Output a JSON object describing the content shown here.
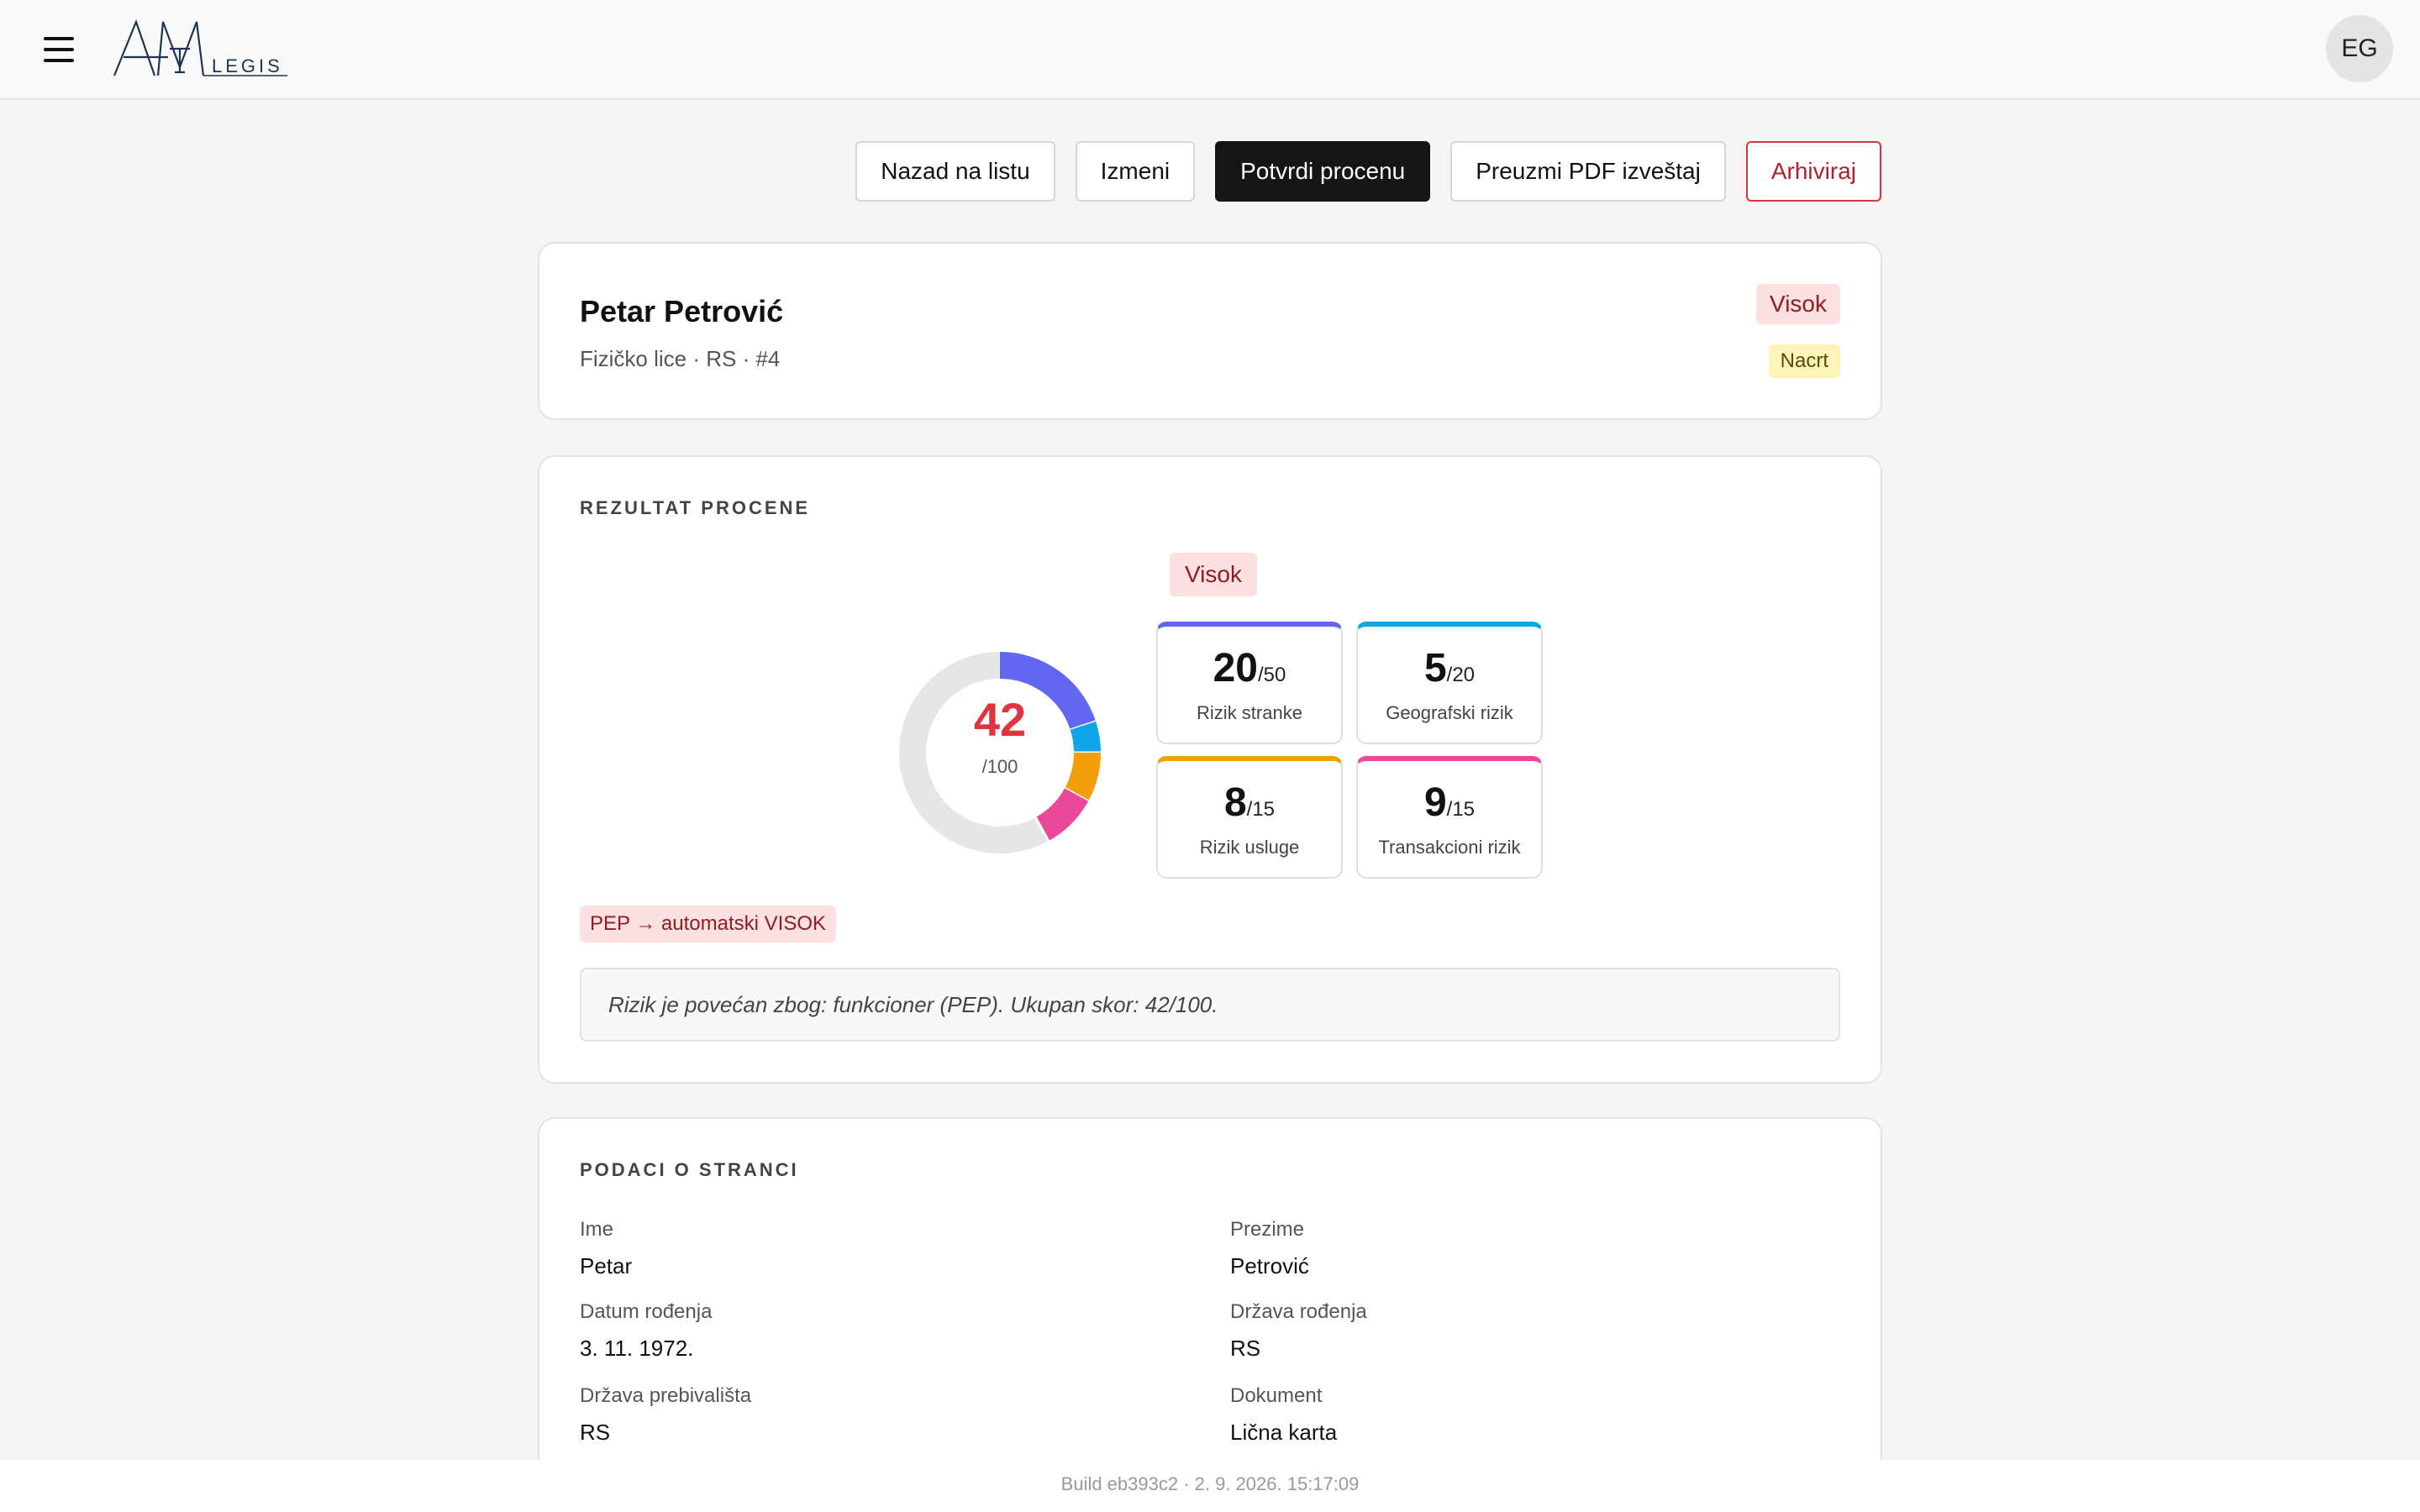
{
  "header": {
    "logo_text": "AML LEGIS",
    "avatar_initials": "EG"
  },
  "actions": {
    "back": "Nazad na listu",
    "edit": "Izmeni",
    "confirm": "Potvrdi procenu",
    "pdf": "Preuzmi PDF izveštaj",
    "archive": "Arhiviraj"
  },
  "colors": {
    "risk_customer": "#6366f1",
    "risk_geo": "#0ea5e9",
    "risk_service": "#f59e0b",
    "risk_transaction": "#ec4899",
    "score": "#e0353f"
  },
  "profile": {
    "name": "Petar Petrović",
    "subtitle": "Fizičko lice · RS · #4",
    "risk_level": "Visok",
    "status": "Nacrt"
  },
  "result": {
    "title": "REZULTAT PROCENE",
    "level": "Visok",
    "score": "42",
    "max": "/100",
    "score_value": 42,
    "score_total": 100,
    "components": [
      {
        "value": "20",
        "max": "/50",
        "label": "Rizik stranke",
        "points": 20
      },
      {
        "value": "5",
        "max": "/20",
        "label": "Geografski rizik",
        "points": 5
      },
      {
        "value": "8",
        "max": "/15",
        "label": "Rizik usluge",
        "points": 8
      },
      {
        "value": "9",
        "max": "/15",
        "label": "Transakcioni rizik",
        "points": 9
      }
    ],
    "pep_badge": "PEP → automatski VISOK",
    "note": "Rizik je povećan zbog: funkcioner (PEP). Ukupan skor: 42/100."
  },
  "client": {
    "title": "PODACI O STRANCI",
    "fields": [
      {
        "label": "Ime",
        "value": "Petar"
      },
      {
        "label": "Prezime",
        "value": "Petrović"
      },
      {
        "label": "Datum rođenja",
        "value": "3. 11. 1972."
      },
      {
        "label": "Država rođenja",
        "value": "RS"
      },
      {
        "label": "Država prebivališta",
        "value": "RS"
      },
      {
        "label": "Dokument",
        "value": "Lična karta"
      }
    ]
  },
  "footer": {
    "build": "Build eb393c2 · 2. 9. 2026. 15:17:09"
  }
}
